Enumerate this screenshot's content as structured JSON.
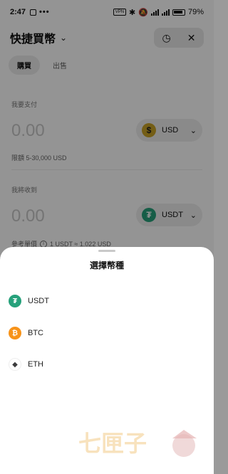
{
  "status": {
    "time": "2:47",
    "dots": "•••",
    "vpn": "VPN",
    "battery": "79%"
  },
  "header": {
    "title": "快捷買幣",
    "chevron_icon": "chevron-down-icon",
    "history_icon": "history-icon",
    "close_icon": "close-icon"
  },
  "tabs": [
    {
      "label": "購買",
      "active": true
    },
    {
      "label": "出售",
      "active": false
    }
  ],
  "pay": {
    "label": "我要支付",
    "amount_placeholder": "0.00",
    "currency": "USD",
    "currency_symbol": "$",
    "currency_color": "#c9a227",
    "limit": "限額 5-30,000 USD"
  },
  "receive": {
    "label": "我將收到",
    "amount_placeholder": "0.00",
    "currency": "USDT",
    "currency_symbol": "₮",
    "currency_color": "#26a17b",
    "ref_label": "參考單價",
    "ref_rate": "1 USDT ≈ 1.022 USD"
  },
  "sheet": {
    "title": "選擇幣種",
    "coins": [
      {
        "label": "USDT",
        "symbol": "₮",
        "color": "#26a17b"
      },
      {
        "label": "BTC",
        "symbol": "₿",
        "color": "#f7931a"
      },
      {
        "label": "ETH",
        "symbol": "◆",
        "color": "#3c3c3d"
      }
    ]
  },
  "watermark": {
    "text": "七匣子"
  }
}
